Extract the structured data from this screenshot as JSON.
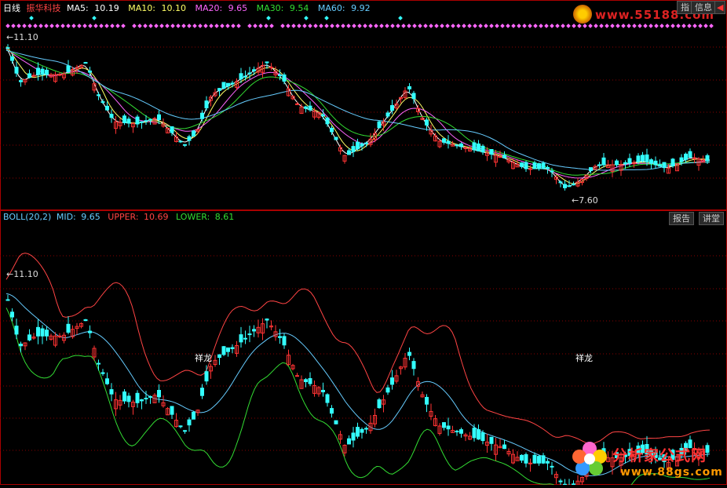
{
  "top_panel": {
    "period": "日线",
    "stock_name": "振华科技",
    "ma": [
      {
        "label": "MA5:",
        "value": "10.19",
        "color": "#ffffff"
      },
      {
        "label": "MA10:",
        "value": "10.10",
        "color": "#ffff66"
      },
      {
        "label": "MA20:",
        "value": "9.65",
        "color": "#ff66ff"
      },
      {
        "label": "MA30:",
        "value": "9.54",
        "color": "#33dd33"
      },
      {
        "label": "MA60:",
        "value": "9.92",
        "color": "#66ccff"
      }
    ],
    "high_label": "11.10",
    "low_label": "7.60"
  },
  "bottom_panel": {
    "indicator": "BOLL(20,2)",
    "lines": [
      {
        "label": "MID:",
        "value": "9.65",
        "color": "#66ccff"
      },
      {
        "label": "UPPER:",
        "value": "10.69",
        "color": "#ff4444"
      },
      {
        "label": "LOWER:",
        "value": "8.61",
        "color": "#33dd33"
      }
    ],
    "high_label": "11.10",
    "tag_1": "祥龙",
    "tag_2": "祥龙"
  },
  "buttons": {
    "report": "报告",
    "lecture": "讲堂",
    "guide": "指",
    "info": "信息"
  },
  "watermark": {
    "top_url": "www.55188.com",
    "bottom_name": "分析家公式网",
    "bottom_url": "www.88gs.com"
  },
  "colors": {
    "up": "#ff3333",
    "down": "#33ffff",
    "grid": "#880000",
    "background": "#000000"
  }
}
